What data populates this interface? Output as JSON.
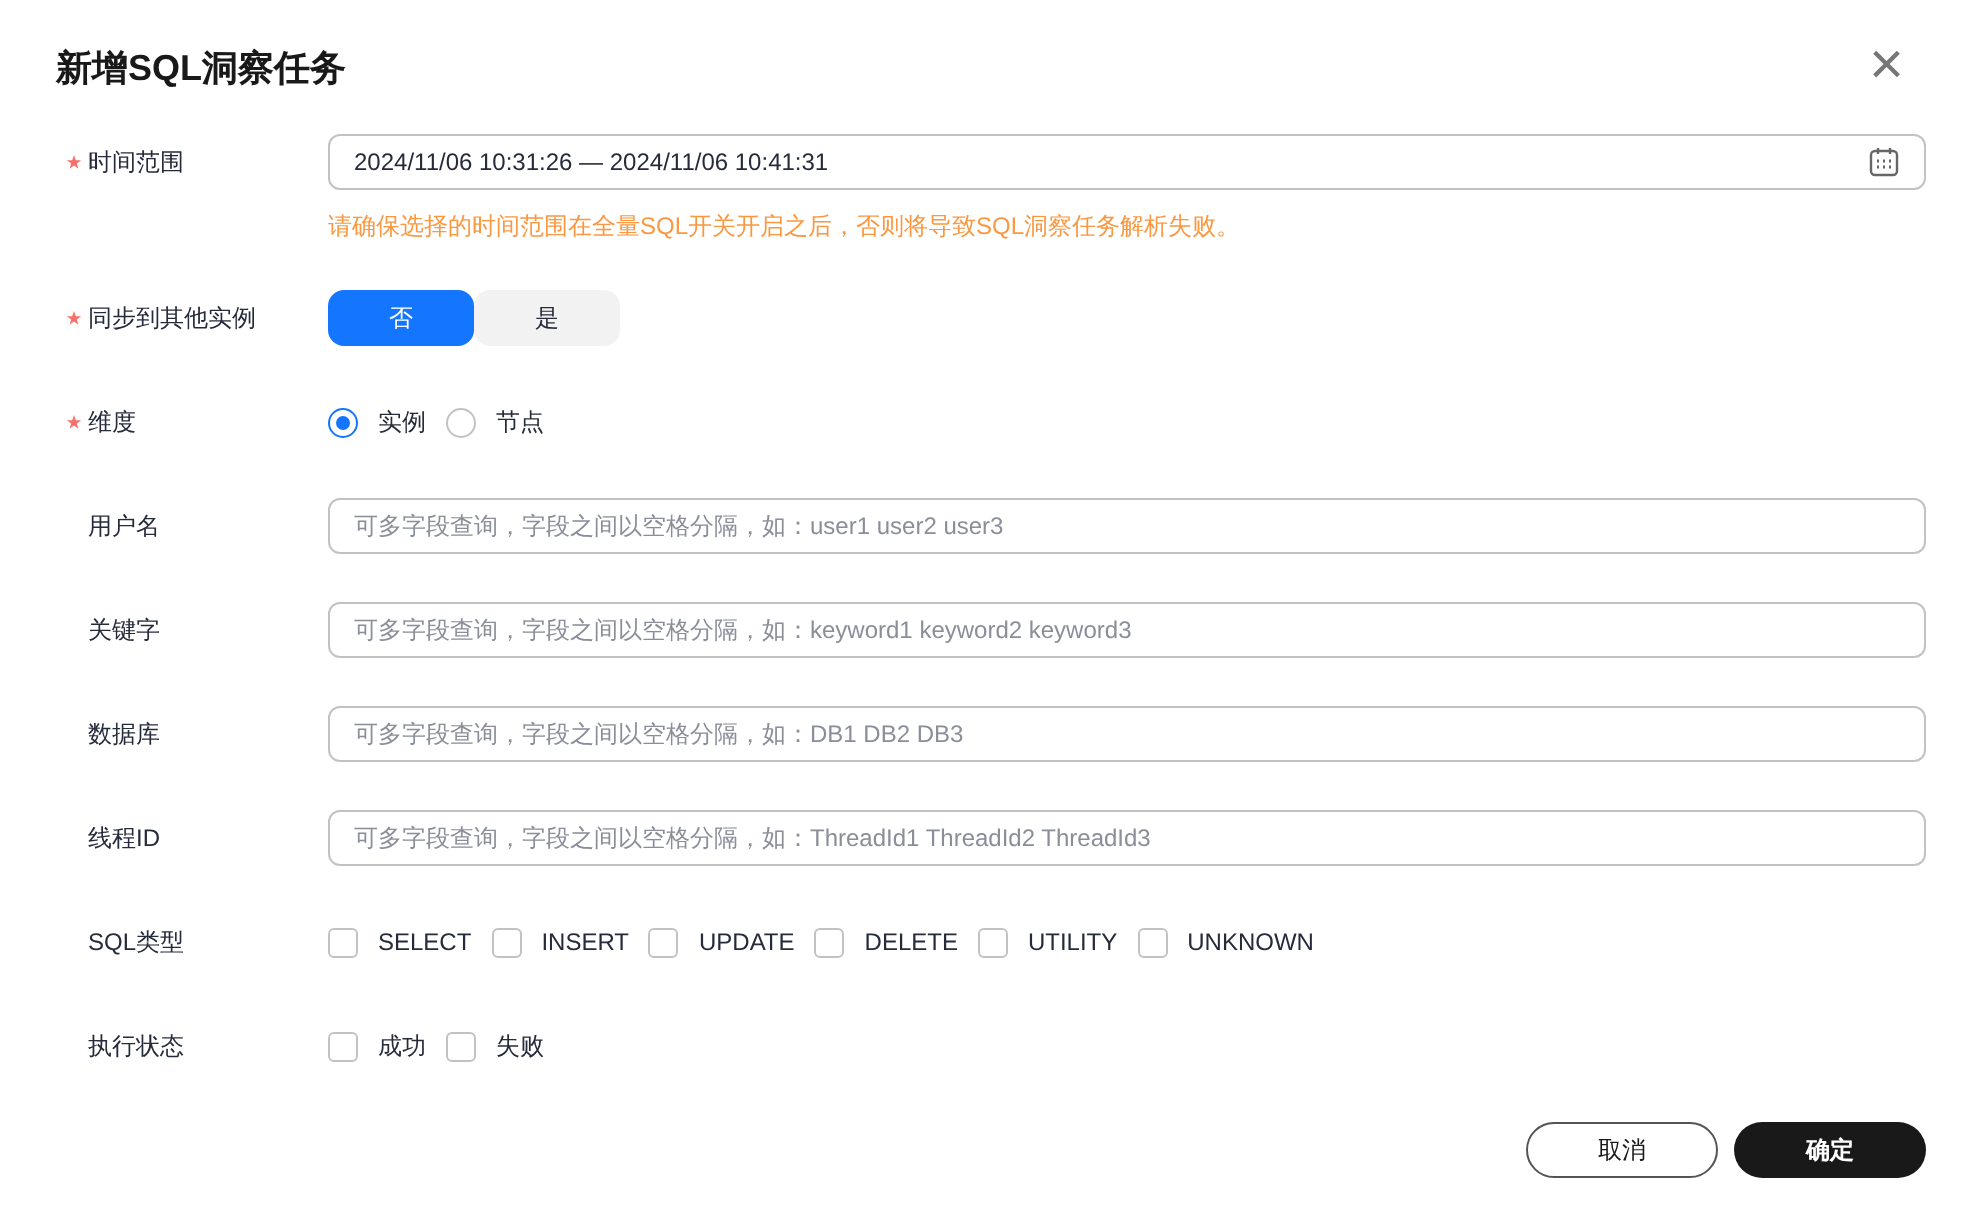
{
  "dialog": {
    "title": "新增SQL洞察任务",
    "close": "×"
  },
  "fields": [
    {
      "kind": "range",
      "label": "时间范围",
      "required": true,
      "value": "2024/11/06 10:31:26 — 2024/11/06 10:41:31",
      "hint": "请确保选择的时间范围在全量SQL开关开启之后，否则将导致SQL洞察任务解析失败。"
    },
    {
      "kind": "toggle",
      "label": "同步到其他实例",
      "required": true,
      "options": [
        {
          "label": "否",
          "selected": true
        },
        {
          "label": "是",
          "selected": false
        }
      ]
    },
    {
      "kind": "radio",
      "label": "维度",
      "required": true,
      "options": [
        {
          "label": "实例",
          "selected": true
        },
        {
          "label": "节点",
          "selected": false
        }
      ]
    },
    {
      "kind": "text",
      "label": "用户名",
      "required": false,
      "placeholder": "可多字段查询，字段之间以空格分隔，如：user1 user2 user3"
    },
    {
      "kind": "text",
      "label": "关键字",
      "required": false,
      "placeholder": "可多字段查询，字段之间以空格分隔，如：keyword1 keyword2 keyword3"
    },
    {
      "kind": "text",
      "label": "数据库",
      "required": false,
      "placeholder": "可多字段查询，字段之间以空格分隔，如：DB1 DB2 DB3"
    },
    {
      "kind": "text",
      "label": "线程ID",
      "required": false,
      "placeholder": "可多字段查询，字段之间以空格分隔，如：ThreadId1 ThreadId2 ThreadId3"
    },
    {
      "kind": "checkbox",
      "label": "SQL类型",
      "required": false,
      "options": [
        {
          "label": "SELECT",
          "checked": false
        },
        {
          "label": "INSERT",
          "checked": false
        },
        {
          "label": "UPDATE",
          "checked": false
        },
        {
          "label": "DELETE",
          "checked": false
        },
        {
          "label": "UTILITY",
          "checked": false
        },
        {
          "label": "UNKNOWN",
          "checked": false
        }
      ]
    },
    {
      "kind": "checkbox",
      "label": "执行状态",
      "required": false,
      "options": [
        {
          "label": "成功",
          "checked": false
        },
        {
          "label": "失败",
          "checked": false
        }
      ]
    }
  ],
  "buttons": [
    {
      "label": "取消",
      "kind": "secondary"
    },
    {
      "label": "确定",
      "kind": "primary"
    }
  ]
}
